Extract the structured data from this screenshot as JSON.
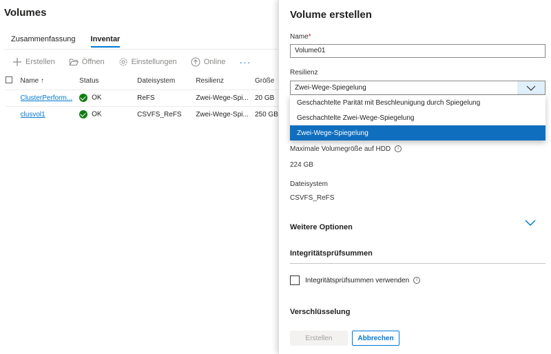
{
  "left": {
    "title": "Volumes",
    "tabs": [
      {
        "label": "Zusammenfassung",
        "active": false
      },
      {
        "label": "Inventar",
        "active": true
      }
    ],
    "commands": [
      {
        "label": "Erstellen",
        "icon": "plus-icon"
      },
      {
        "label": "Öffnen",
        "icon": "folder-open-icon"
      },
      {
        "label": "Einstellungen",
        "icon": "gear-icon"
      },
      {
        "label": "Online",
        "icon": "arrow-up-circle-icon"
      }
    ],
    "more_label": "···",
    "table": {
      "headers": [
        "Name",
        "Status",
        "Dateisystem",
        "Resilienz",
        "Größe"
      ],
      "sort_indicator": "↑",
      "rows": [
        {
          "name": "ClusterPerform...",
          "status": "OK",
          "fs": "ReFS",
          "resilience": "Zwei-Wege-Spi...",
          "size": "20 GB"
        },
        {
          "name": "clusvol1",
          "status": "OK",
          "fs": "CSVFS_ReFS",
          "resilience": "Zwei-Wege-Spi...",
          "size": "250 GB"
        }
      ]
    }
  },
  "panel": {
    "title": "Volume erstellen",
    "name_label": "Name",
    "required_marker": "*",
    "name_value": "Volume01",
    "resilience_label": "Resilienz",
    "resilience_value": "Zwei-Wege-Spiegelung",
    "options": [
      {
        "label": "Geschachtelte Parität mit Beschleunigung durch Spiegelung",
        "selected": false
      },
      {
        "label": "Geschachtelte Zwei-Wege-Spiegelung",
        "selected": false
      },
      {
        "label": "Zwei-Wege-Spiegelung",
        "selected": true
      }
    ],
    "max_size_label": "Maximale Volumegröße auf HDD",
    "max_size_value": "224 GB",
    "fs_label": "Dateisystem",
    "fs_value": "CSVFS_ReFS",
    "more_options": "Weitere Optionen",
    "integrity_heading": "Integritätsprüfsummen",
    "integrity_checkbox": "Integritätsprüfsummen verwenden",
    "encryption_heading": "Verschlüsselung",
    "create_button": "Erstellen",
    "cancel_button": "Abbrechen",
    "info_glyph": "i"
  },
  "colors": {
    "accent": "#0078d4",
    "selected_option": "#106ebe",
    "ok_green": "#107c10"
  }
}
